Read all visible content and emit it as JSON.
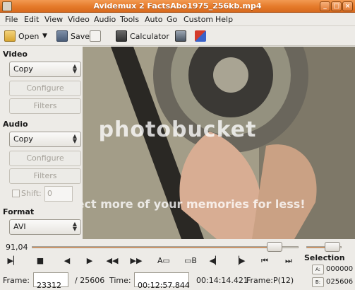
{
  "window": {
    "title": "Avidemux 2 FactsAbo1975_256kb.mp4",
    "controls": [
      "minimize-icon",
      "maximize-icon",
      "close-icon"
    ]
  },
  "menu": {
    "items": [
      "File",
      "Edit",
      "View",
      "Video",
      "Audio",
      "Tools",
      "Auto",
      "Go",
      "Custom",
      "Help"
    ]
  },
  "toolbar": {
    "open_label": "Open",
    "save_label": "Save",
    "calculator_label": "Calculator"
  },
  "video_panel": {
    "section_label": "Video",
    "codec_value": "Copy",
    "configure_label": "Configure",
    "filters_label": "Filters"
  },
  "audio_panel": {
    "section_label": "Audio",
    "codec_value": "Copy",
    "configure_label": "Configure",
    "filters_label": "Filters",
    "shift_label": "Shift:",
    "shift_value": "0"
  },
  "format_panel": {
    "section_label": "Format",
    "format_value": "AVI"
  },
  "watermark": {
    "brand": "photobucket",
    "tagline": "Protect more of your memories for less!"
  },
  "slider": {
    "position_label": "91,04",
    "position_fraction": 0.9104
  },
  "status": {
    "frame_label": "Frame:",
    "frame_value": "23312",
    "total_frames": "/ 25606",
    "time_label": "Time:",
    "time_value": "00:12:57.844",
    "total_time": "00:14:14.421",
    "frame_type": "Frame:P(12)"
  },
  "selection": {
    "title": "Selection",
    "a_label": "A:",
    "a_value": "000000",
    "b_label": "B:",
    "b_value": "025606"
  },
  "colors": {
    "titlebar": "#e57a2a",
    "accent_fill": "#e48a45"
  }
}
